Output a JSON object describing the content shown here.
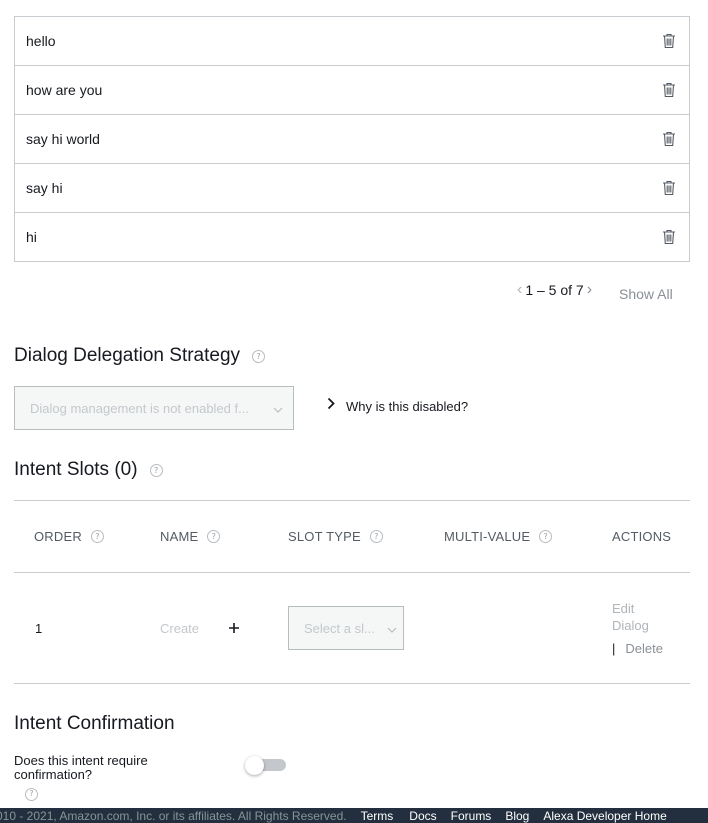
{
  "utterances": [
    "hello",
    "how are you",
    "say hi world",
    "say hi",
    "hi"
  ],
  "pagination": {
    "range": "1 – 5 of 7",
    "show_all": "Show All"
  },
  "dialog": {
    "heading": "Dialog Delegation Strategy",
    "select_placeholder": "Dialog management is not enabled f...",
    "why_link": "Why is this disabled?"
  },
  "slots": {
    "heading": "Intent Slots (0)",
    "columns": {
      "order": "ORDER",
      "name": "NAME",
      "slot_type": "SLOT TYPE",
      "multi_value": "MULTI-VALUE",
      "actions": "ACTIONS"
    },
    "row": {
      "order": "1",
      "name_placeholder": "Create",
      "slot_type_placeholder": "Select a sl...",
      "edit_dialog_line1": "Edit",
      "edit_dialog_line2": "Dialog",
      "delete": "Delete",
      "separator": "|"
    }
  },
  "confirmation": {
    "heading": "Intent Confirmation",
    "question": "Does this intent require confirmation?",
    "enabled": false
  },
  "footer": {
    "copyright": "010 - 2021, Amazon.com, Inc. or its affiliates. All Rights Reserved.",
    "links": [
      "Terms",
      "Docs",
      "Forums",
      "Blog",
      "Alexa Developer Home"
    ]
  },
  "icons": {
    "trash": "trash-icon",
    "help": "help-icon",
    "chevron": "chevron-icon",
    "plus": "plus-icon"
  },
  "colors": {
    "text": "#16191f",
    "muted": "#8a9096",
    "border": "#c7ccd1",
    "footer_bg": "#232f3e"
  }
}
